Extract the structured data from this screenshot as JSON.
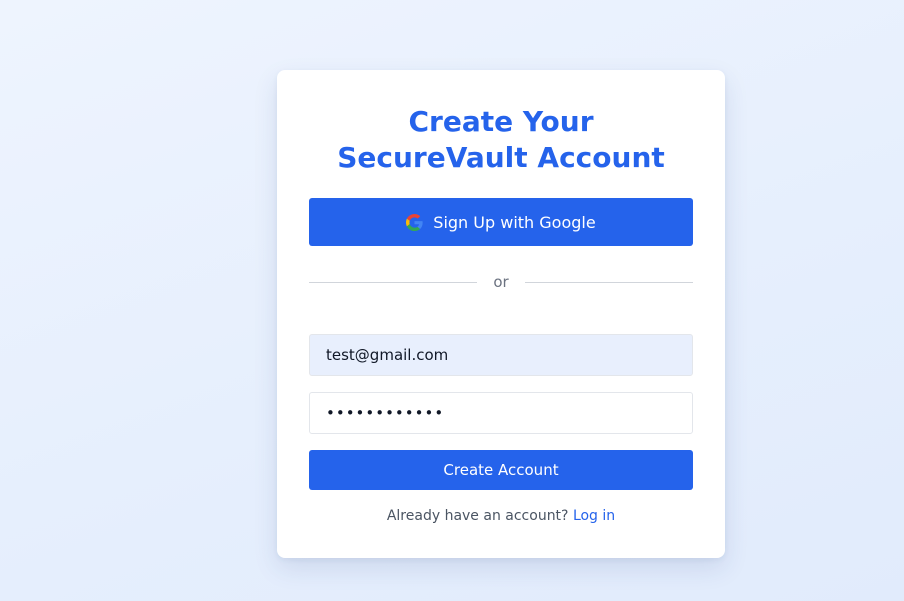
{
  "page": {
    "title": "Create Your SecureVault Account"
  },
  "google_button": {
    "label": "Sign Up with Google",
    "icon": "google-icon"
  },
  "divider": {
    "text": "or"
  },
  "form": {
    "email_value": "test@gmail.com",
    "password_value": "••••••••••••"
  },
  "create_button": {
    "label": "Create Account"
  },
  "footer": {
    "prompt": "Already have an account?",
    "link_label": "Log in"
  },
  "colors": {
    "accent": "#2563eb",
    "background": "#e8f0fd",
    "autofill": "#e8effd"
  }
}
